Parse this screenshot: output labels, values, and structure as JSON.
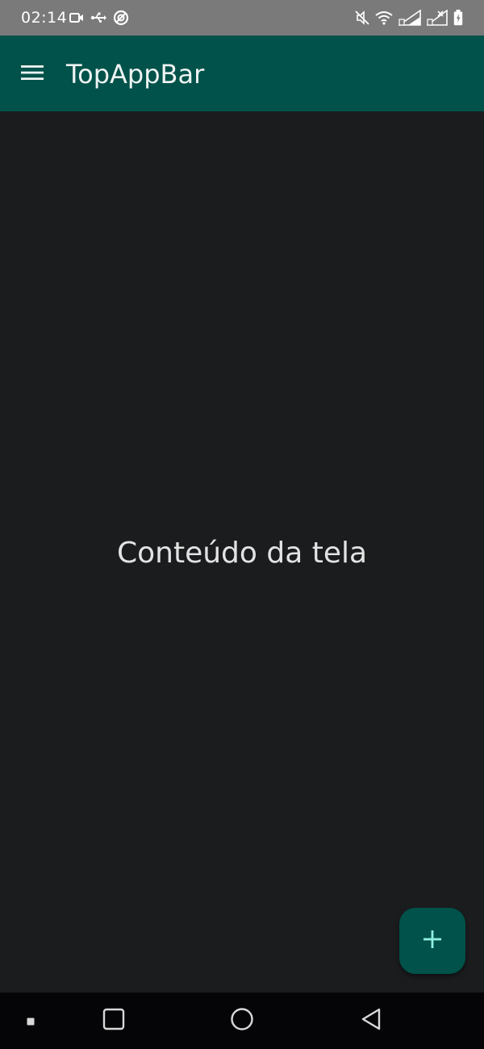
{
  "status_bar": {
    "time": "02:14",
    "icons_left": [
      "video-icon",
      "usb-icon",
      "sync-icon"
    ],
    "icons_right": [
      "mute-icon",
      "wifi-icon",
      "signal-icon",
      "signal-no-data-icon",
      "battery-icon"
    ]
  },
  "top_app_bar": {
    "title": "TopAppBar",
    "nav_icon": "menu-icon",
    "background": "#00524a"
  },
  "content": {
    "text": "Conteúdo da tela",
    "background": "#1b1c1e"
  },
  "fab": {
    "icon": "plus-icon",
    "background": "#00524a",
    "icon_color": "#8ff0e2"
  },
  "nav_bar": {
    "buttons": [
      "recents-dot-icon",
      "overview-square-icon",
      "home-circle-icon",
      "back-triangle-icon"
    ]
  }
}
